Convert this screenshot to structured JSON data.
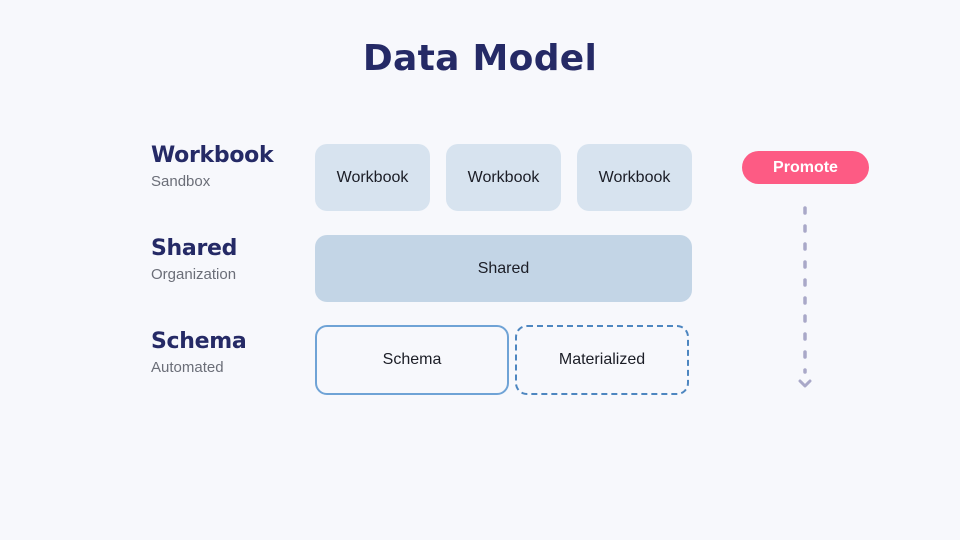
{
  "title": "Data Model",
  "tiers": [
    {
      "name": "Workbook",
      "subtitle": "Sandbox"
    },
    {
      "name": "Shared",
      "subtitle": "Organization"
    },
    {
      "name": "Schema",
      "subtitle": "Automated"
    }
  ],
  "workbook_boxes": [
    "Workbook",
    "Workbook",
    "Workbook"
  ],
  "shared_box": "Shared",
  "schema_box": "Schema",
  "materialized_box": "Materialized",
  "promote_button": "Promote",
  "colors": {
    "title": "#252a66",
    "workbook_fill": "#d7e3ef",
    "shared_fill": "#c3d5e6",
    "schema_border": "#6fa3d6",
    "materialized_border": "#4d86c0",
    "promote": "#fd5b84",
    "arrow": "#a9a8c8"
  }
}
